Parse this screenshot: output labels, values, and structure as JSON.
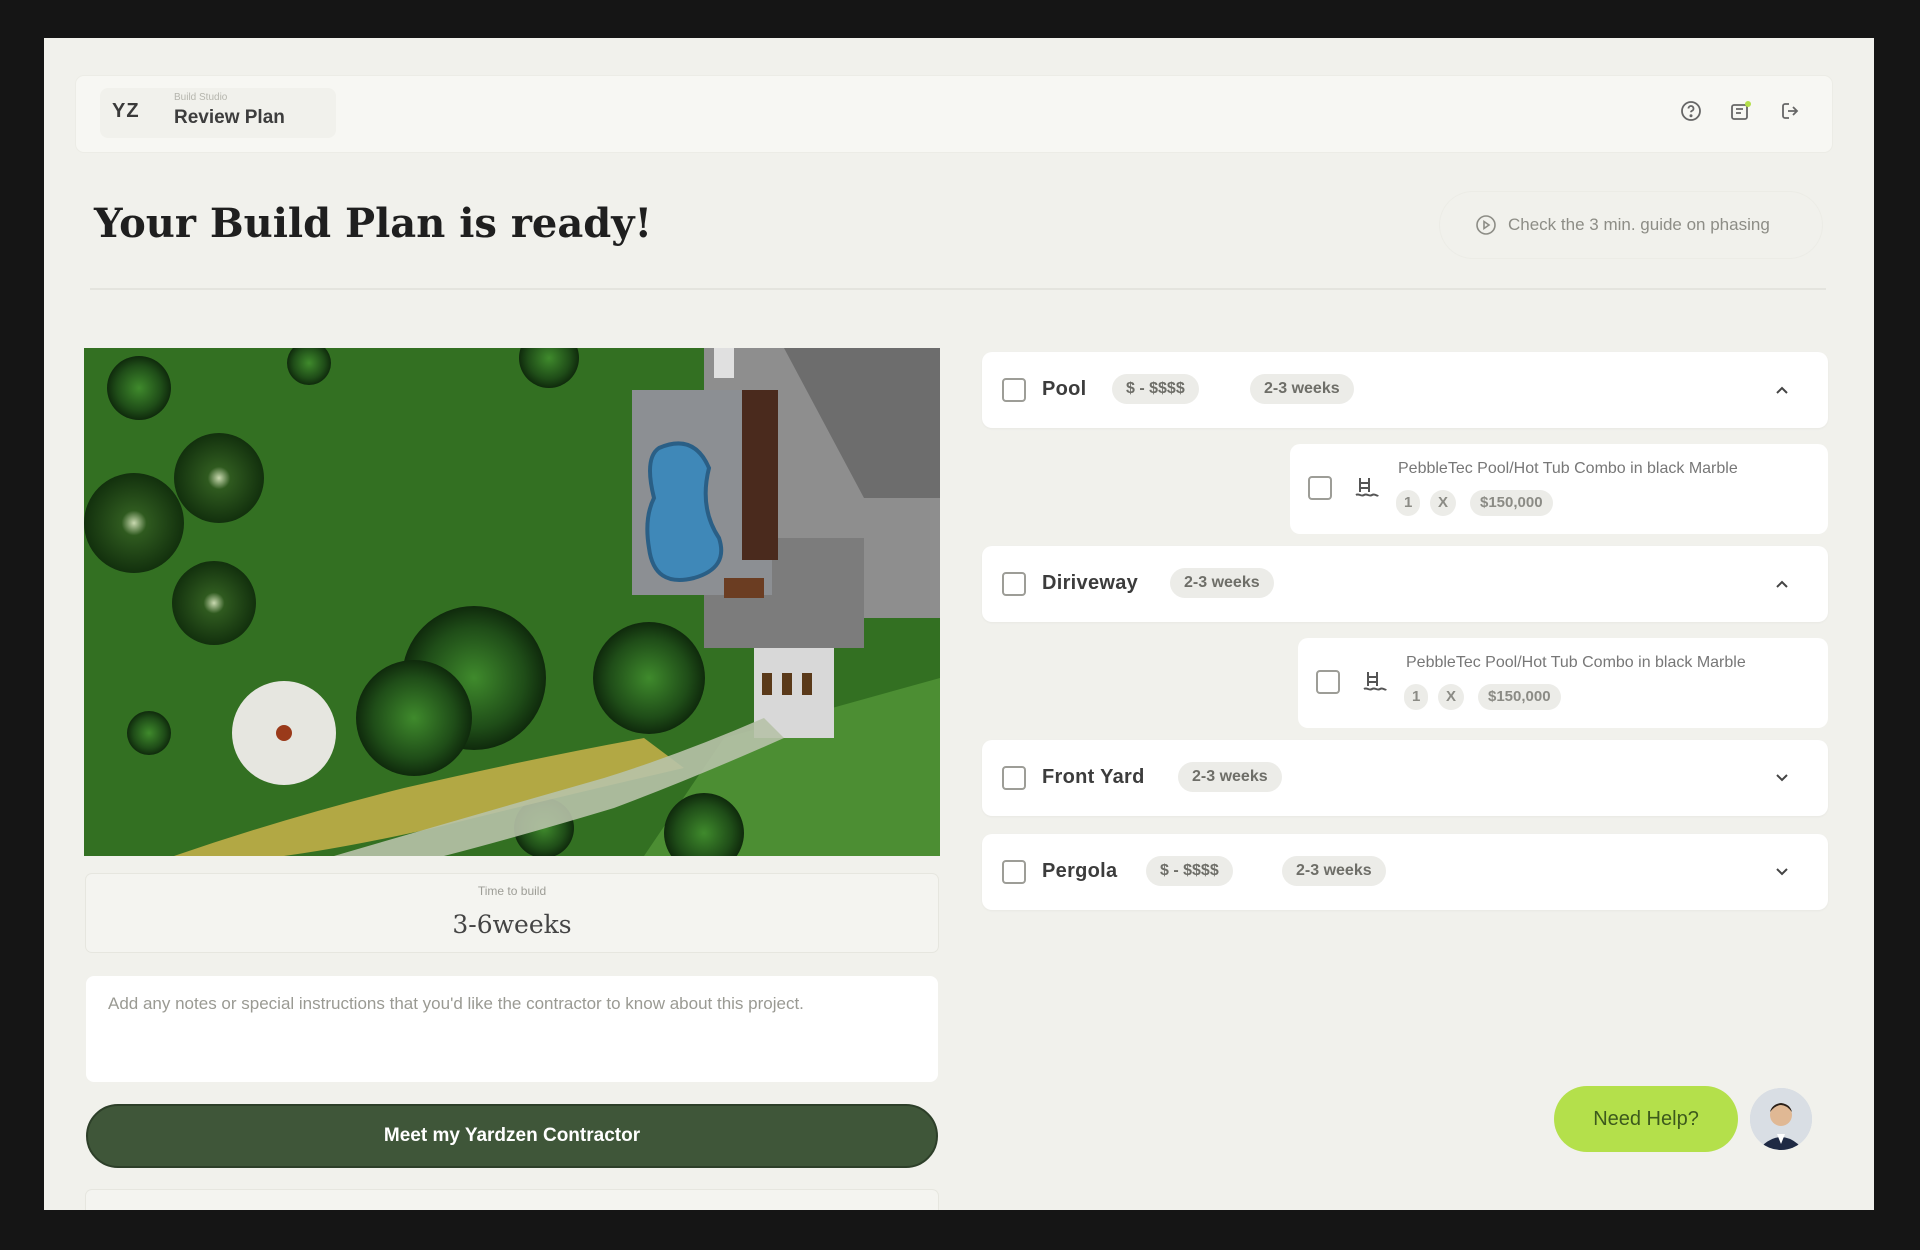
{
  "header": {
    "logo": "YZ",
    "breadcrumb_small": "Build Studio",
    "breadcrumb_title": "Review Plan",
    "icons": [
      "help-icon",
      "notification-icon",
      "logout-icon"
    ]
  },
  "page": {
    "title": "Your Build Plan is ready!",
    "guide_button": "Check the 3 min. guide on phasing"
  },
  "plan": {
    "time_label": "Time to build",
    "time_value": "3-6weeks",
    "notes_placeholder": "Add any notes or special instructions that you'd like the contractor to know about this project.",
    "cta_label": "Meet my Yardzen Contractor"
  },
  "phases": [
    {
      "name": "Pool",
      "price": "$ - $$$$",
      "duration": "2-3 weeks",
      "expanded": true,
      "item": {
        "title": "PebbleTec Pool/Hot Tub Combo in black Marble",
        "qty": "1",
        "times": "X",
        "price": "$150,000"
      }
    },
    {
      "name": "Diriveway",
      "duration": "2-3 weeks",
      "expanded": true,
      "item": {
        "title": "PebbleTec Pool/Hot Tub Combo in black Marble",
        "qty": "1",
        "times": "X",
        "price": "$150,000"
      }
    },
    {
      "name": "Front Yard",
      "duration": "2-3 weeks",
      "expanded": false
    },
    {
      "name": "Pergola",
      "price": "$ - $$$$",
      "duration": "2-3 weeks",
      "expanded": false
    }
  ],
  "help": {
    "label": "Need Help?"
  },
  "colors": {
    "background": "#f1f1ec",
    "cta": "#3f5639",
    "help": "#b4e04b",
    "lawn": "#2f6a1f"
  }
}
